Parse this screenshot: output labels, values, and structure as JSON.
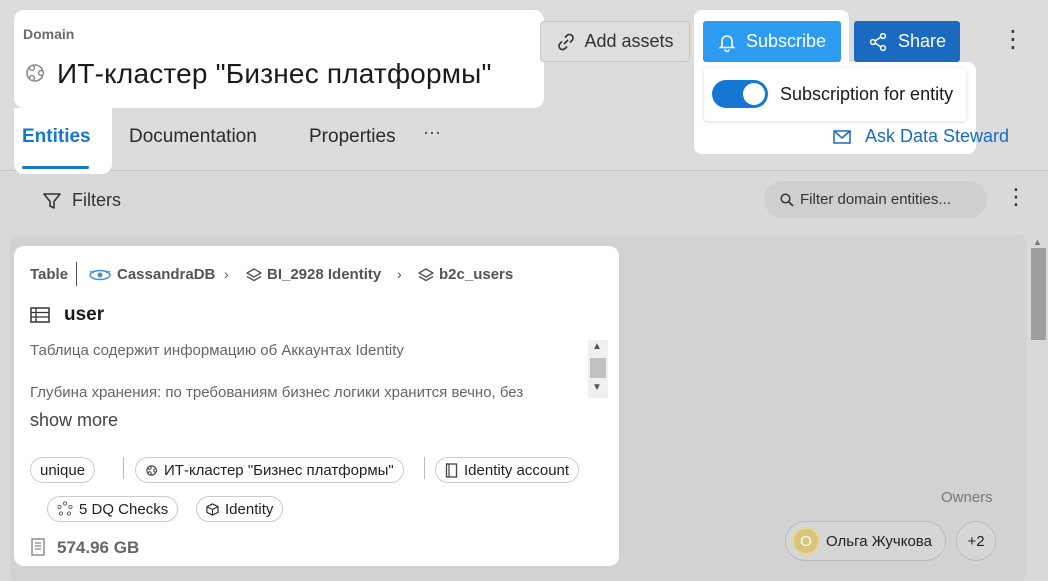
{
  "header": {
    "domain_label": "Domain",
    "title": "ИТ-кластер \"Бизнес платформы\"",
    "add_assets_label": "Add assets",
    "subscribe_label": "Subscribe",
    "share_label": "Share",
    "subscription_toggle_label": "Subscription for entity",
    "subscription_enabled": true
  },
  "tabs": [
    {
      "label": "Entities",
      "active": true
    },
    {
      "label": "Documentation",
      "active": false
    },
    {
      "label": "Properties",
      "active": false
    }
  ],
  "tabs_more": "···",
  "ask_steward_label": "Ask Data Steward",
  "filter_bar": {
    "filters_label": "Filters",
    "search_placeholder": "Filter domain entities..."
  },
  "card": {
    "breadcrumb": {
      "type": "Table",
      "service": "CassandraDB",
      "schema": "BI_2928 Identity",
      "database": "b2c_users"
    },
    "name": "user",
    "description_line1": "Таблица содержит информацию об Аккаунтах Identity",
    "description_line2": "Глубина хранения: по требованиям бизнес логики хранится вечно, без",
    "show_more": "show more",
    "chips": {
      "unique": "unique",
      "domain": "ИТ-кластер \"Бизнес платформы\"",
      "glossary": "Identity account",
      "dq": "5 DQ Checks",
      "identity": "Identity"
    },
    "size": "574.96 GB"
  },
  "owners": {
    "label": "Owners",
    "owner_initial": "О",
    "owner_name": "Ольга Жучкова",
    "more": "+2"
  },
  "colors": {
    "accent": "#1677d2",
    "subscribe": "#2d9cf0",
    "share": "#1a6bbf"
  }
}
